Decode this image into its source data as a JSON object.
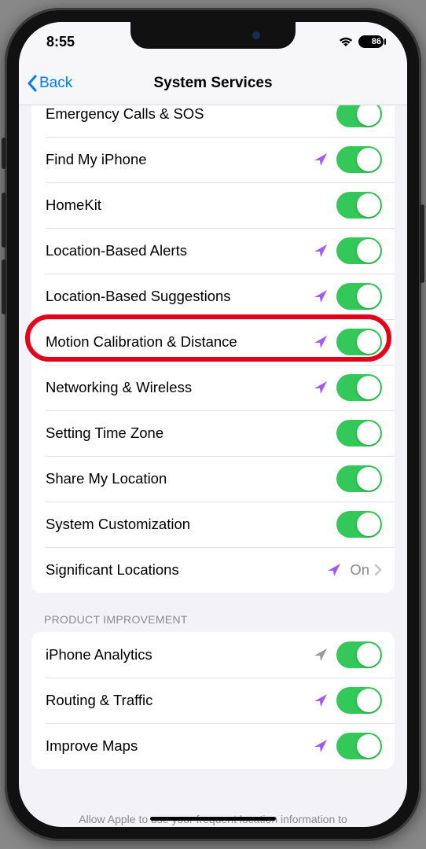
{
  "status": {
    "time": "8:55",
    "battery": "86"
  },
  "nav": {
    "back_label": "Back",
    "title": "System Services"
  },
  "section1": {
    "items": [
      {
        "label": "Emergency Calls & SOS",
        "arrow": "none",
        "toggle": "on"
      },
      {
        "label": "Find My iPhone",
        "arrow": "purple",
        "toggle": "on"
      },
      {
        "label": "HomeKit",
        "arrow": "none",
        "toggle": "on"
      },
      {
        "label": "Location-Based Alerts",
        "arrow": "purple",
        "toggle": "on"
      },
      {
        "label": "Location-Based Suggestions",
        "arrow": "purple",
        "toggle": "on"
      },
      {
        "label": "Motion Calibration & Distance",
        "arrow": "purple",
        "toggle": "on",
        "highlight": true
      },
      {
        "label": "Networking & Wireless",
        "arrow": "purple",
        "toggle": "on"
      },
      {
        "label": "Setting Time Zone",
        "arrow": "none",
        "toggle": "on"
      },
      {
        "label": "Share My Location",
        "arrow": "none",
        "toggle": "on"
      },
      {
        "label": "System Customization",
        "arrow": "none",
        "toggle": "on"
      }
    ],
    "link": {
      "label": "Significant Locations",
      "arrow": "purple",
      "value": "On"
    }
  },
  "section2": {
    "header": "PRODUCT IMPROVEMENT",
    "items": [
      {
        "label": "iPhone Analytics",
        "arrow": "gray",
        "toggle": "on"
      },
      {
        "label": "Routing & Traffic",
        "arrow": "purple",
        "toggle": "on"
      },
      {
        "label": "Improve Maps",
        "arrow": "purple",
        "toggle": "on"
      }
    ]
  },
  "footer_text": "Allow Apple to use your frequent location information to"
}
